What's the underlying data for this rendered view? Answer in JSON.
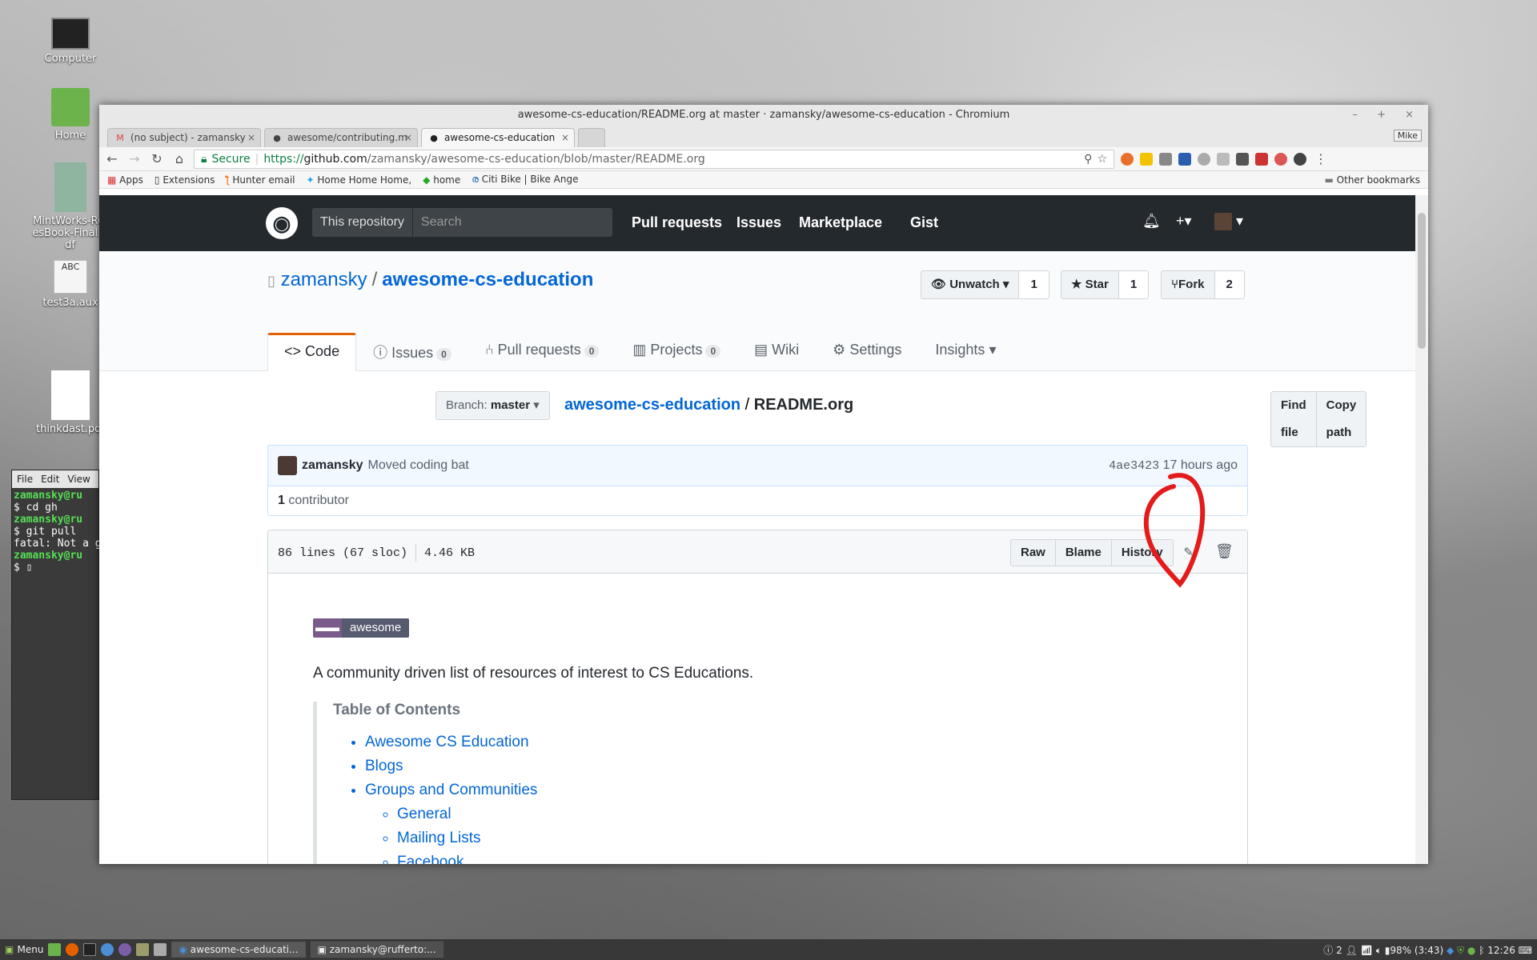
{
  "desktop": {
    "icons": [
      {
        "label": "Computer"
      },
      {
        "label": "Home"
      },
      {
        "label": "MintWorks-RulesBook-Final.pdf"
      },
      {
        "label": "test3a.aux"
      },
      {
        "label": "thinkdast.pdf"
      }
    ]
  },
  "terminal": {
    "menu": [
      "File",
      "Edit",
      "View"
    ],
    "lines": [
      "zamansky@ru",
      "$ cd gh",
      "zamansky@ru",
      "$ git pull",
      "fatal: Not a g",
      "zamansky@ru",
      "$ "
    ]
  },
  "browser": {
    "window_title": "awesome-cs-education/README.org at master · zamansky/awesome-cs-education - Chromium",
    "profile": "Mike",
    "tabs": [
      {
        "title": "(no subject) - zamansky",
        "icon": "gmail-icon",
        "active": false
      },
      {
        "title": "awesome/contributing.m",
        "icon": "github-icon",
        "active": false
      },
      {
        "title": "awesome-cs-education",
        "icon": "github-icon",
        "active": true
      }
    ],
    "url": {
      "secure_label": "Secure",
      "scheme": "https://",
      "host": "github.com",
      "path": "/zamansky/awesome-cs-education/blob/master/README.org"
    },
    "bookmarks": [
      "Apps",
      "Extensions",
      "Hunter email",
      "Home Home Home,",
      "home",
      "Citi Bike | Bike Ange"
    ],
    "other_bookmarks": "Other bookmarks"
  },
  "github": {
    "header": {
      "scope": "This repository",
      "search_placeholder": "Search",
      "nav": [
        "Pull requests",
        "Issues",
        "Marketplace",
        "Gist"
      ]
    },
    "repo": {
      "owner": "zamansky",
      "sep": "/",
      "name": "awesome-cs-education",
      "watch_label": "Unwatch",
      "watch_count": "1",
      "star_label": "Star",
      "star_count": "1",
      "fork_label": "Fork",
      "fork_count": "2"
    },
    "tabs": [
      {
        "label": "Code",
        "count": null
      },
      {
        "label": "Issues",
        "count": "0"
      },
      {
        "label": "Pull requests",
        "count": "0"
      },
      {
        "label": "Projects",
        "count": "0"
      },
      {
        "label": "Wiki",
        "count": null
      },
      {
        "label": "Settings",
        "count": null
      },
      {
        "label": "Insights",
        "count": null
      }
    ],
    "file_nav": {
      "branch_prefix": "Branch:",
      "branch": "master",
      "crumb_repo": "awesome-cs-education",
      "crumb_sep": "/",
      "file_name": "README.org",
      "find_file": "Find file",
      "copy_path": "Copy path"
    },
    "commit": {
      "author": "zamansky",
      "message": "Moved coding bat",
      "sha": "4ae3423",
      "time": "17 hours ago"
    },
    "contributors": {
      "count": "1",
      "label": "contributor"
    },
    "file": {
      "lines": "86 lines (67 sloc)",
      "size": "4.46 KB",
      "actions": [
        "Raw",
        "Blame",
        "History"
      ]
    },
    "readme": {
      "badge_text": "awesome",
      "intro": "A community driven list of resources of interest to CS Educations.",
      "toc_title": "Table of Contents",
      "toc": [
        "Awesome CS Education",
        "Blogs",
        "Groups and Communities"
      ],
      "toc_sub": [
        "General",
        "Mailing Lists",
        "Facebook"
      ]
    }
  },
  "taskbar": {
    "menu": "Menu",
    "apps": [
      "awesome-cs-educati...",
      "zamansky@rufferto:..."
    ],
    "tray": "2",
    "battery": "98% (3:43)",
    "clock": "12:26"
  },
  "colors": {
    "annotation": "#e31b1b",
    "github_dark": "#24292e",
    "link": "#0366d6"
  }
}
